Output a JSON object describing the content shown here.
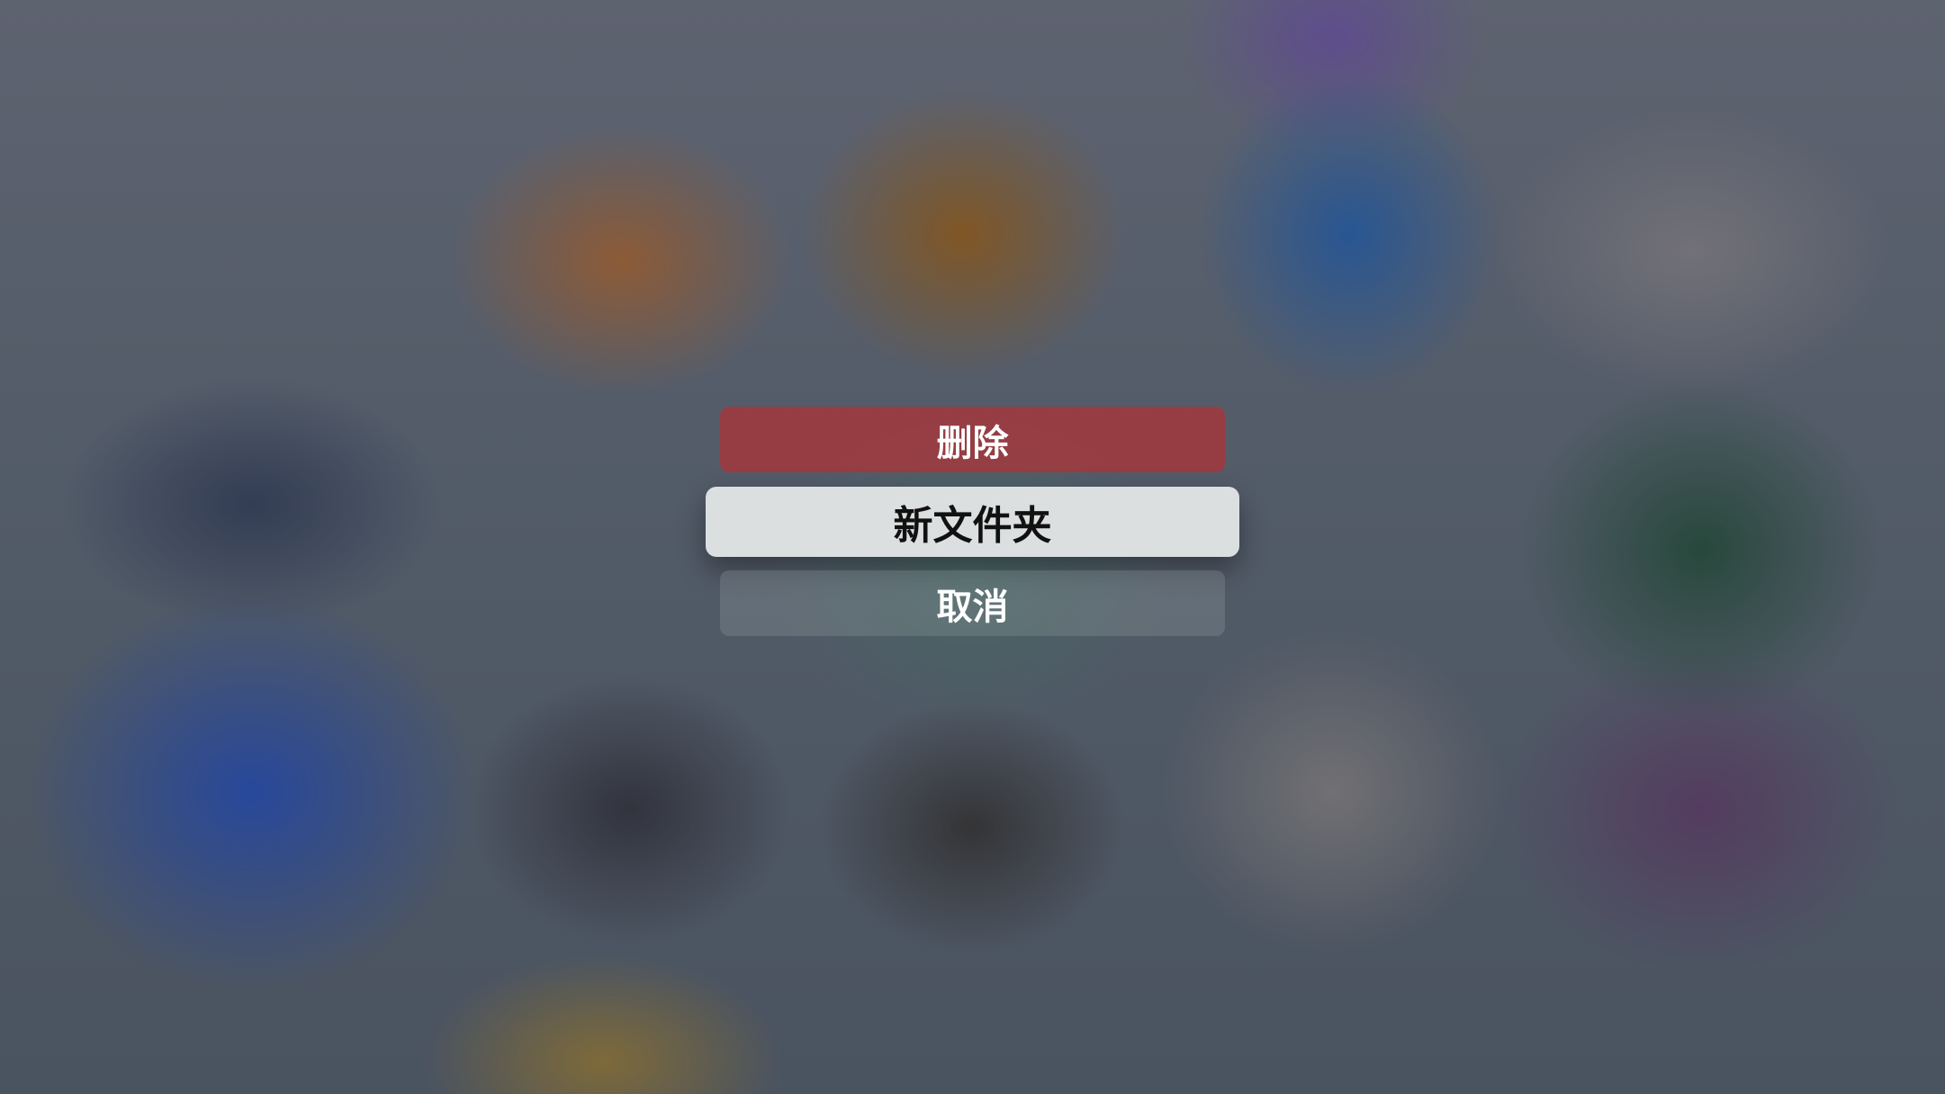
{
  "menu": {
    "options": [
      {
        "label": "删除",
        "role": "destructive"
      },
      {
        "label": "新文件夹",
        "role": "focused"
      },
      {
        "label": "取消",
        "role": "cancel"
      }
    ]
  },
  "colors": {
    "destructive_bg": "#a5373c",
    "focused_bg": "#dcdfe0",
    "focused_text": "#111111",
    "default_text": "#ffffff"
  }
}
